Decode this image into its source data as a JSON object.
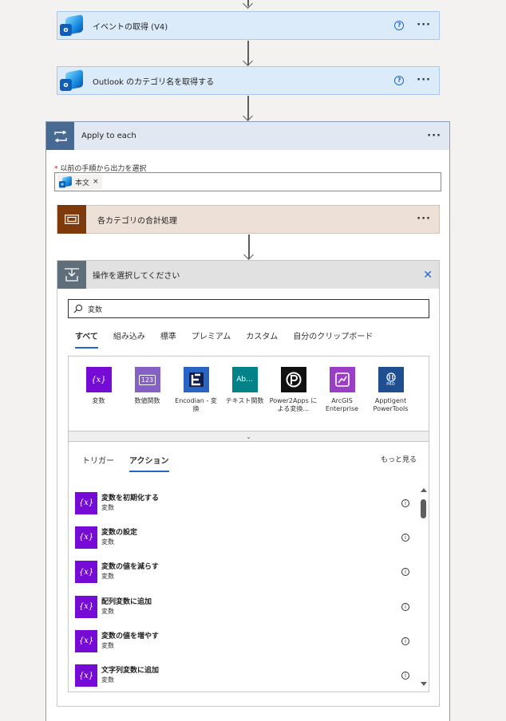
{
  "steps": [
    {
      "title": "イベントの取得 (V4)",
      "help": "?",
      "more": "···",
      "logo_letter": "o"
    },
    {
      "title": "Outlook のカテゴリ名を取得する",
      "help": "?",
      "more": "···",
      "logo_letter": "o"
    }
  ],
  "apply_each": {
    "title": "Apply to each",
    "more": "···",
    "field_required_mark": "*",
    "field_label": "以前の手順から出力を選択",
    "token_label": "本文",
    "token_remove": "×"
  },
  "category_step": {
    "title": "各カテゴリの合計処理",
    "more": "···"
  },
  "chooser": {
    "title": "操作を選択してください",
    "close": "✕",
    "search_value": "変数",
    "tabs": [
      "すべて",
      "組み込み",
      "標準",
      "プレミアム",
      "カスタム",
      "自分のクリップボード"
    ],
    "active_tab": "すべて",
    "connectors": [
      {
        "label": "変数",
        "icon": "{x}",
        "color": "#770bd6"
      },
      {
        "label": "数値関数",
        "icon": "123",
        "color": "#8661c5"
      },
      {
        "label": "Encodian - 変換",
        "icon": "E",
        "color": "#1d3d9e"
      },
      {
        "label": "テキスト関数",
        "icon": "Ab...",
        "color": "#038387"
      },
      {
        "label": "Power2Apps による変換…",
        "icon": "P",
        "color": "#111111"
      },
      {
        "label": "ArcGIS Enterprise",
        "icon": "arcgis",
        "color": "#9a3ec5"
      },
      {
        "label": "Apptigent PowerTools",
        "icon": "PRO",
        "color": "#1f4e91"
      }
    ],
    "expander_icon": "⌄",
    "sub_tabs": [
      "トリガー",
      "アクション"
    ],
    "active_sub_tab": "アクション",
    "see_more": "もっと見る",
    "actions": [
      {
        "name": "変数を初期化する",
        "connector": "変数",
        "icon": "{x}"
      },
      {
        "name": "変数の設定",
        "connector": "変数",
        "icon": "{x}"
      },
      {
        "name": "変数の値を減らす",
        "connector": "変数",
        "icon": "{x}"
      },
      {
        "name": "配列変数に追加",
        "connector": "変数",
        "icon": "{x}"
      },
      {
        "name": "変数の値を増やす",
        "connector": "変数",
        "icon": "{x}"
      },
      {
        "name": "文字列変数に追加",
        "connector": "変数",
        "icon": "{x}"
      }
    ],
    "info_icon": "i"
  },
  "colors": {
    "step_bg": "#dcebfa",
    "apply_header_icon": "#486991",
    "category_icon": "#7f3a0b",
    "variables_brand": "#770bd6",
    "accent": "#2266c9"
  }
}
